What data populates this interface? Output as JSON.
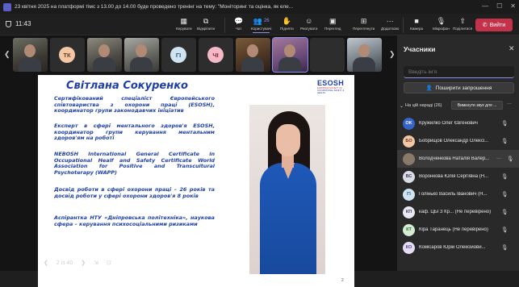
{
  "window": {
    "title": "23 квітня 2025 на платформі тімс з 13.00 до 14.00 буде проведено тренінг на тему: \"Моніторинг та оцінка, як еле...",
    "controls": [
      "—",
      "☐",
      "✕"
    ]
  },
  "toolbar": {
    "time": "11:43",
    "buttons": [
      {
        "label": "Керувати",
        "icon": "▦"
      },
      {
        "label": "Відкріпити",
        "icon": "⧉"
      },
      {
        "label": "Чат",
        "icon": "💬"
      },
      {
        "label": "Користувачі",
        "icon": "👥",
        "badge": "26"
      },
      {
        "label": "Підняти",
        "icon": "✋"
      },
      {
        "label": "Реагувати",
        "icon": "☺"
      },
      {
        "label": "Перегляд",
        "icon": "▣"
      },
      {
        "label": "Переглянути",
        "icon": "⊞"
      },
      {
        "label": "Додатково",
        "icon": "···"
      },
      {
        "label": "Камера",
        "icon": "■"
      },
      {
        "label": "Мікрофон",
        "icon": "🎙"
      },
      {
        "label": "Поділитися",
        "icon": "⇧"
      }
    ],
    "leave_label": "Вийти"
  },
  "strip": {
    "tiles": [
      {
        "kind": "cam",
        "initials": ""
      },
      {
        "kind": "avatar",
        "initials": "ТК",
        "color": "#f3c6a5",
        "fg": "#6b3a1e"
      },
      {
        "kind": "cam2",
        "initials": ""
      },
      {
        "kind": "cam3",
        "initials": ""
      },
      {
        "kind": "avatar",
        "initials": "ГІ",
        "color": "#cfe3f0",
        "fg": "#2a5877"
      },
      {
        "kind": "avatar",
        "initials": "ЧІ",
        "color": "#f4b9c5",
        "fg": "#7d2236"
      },
      {
        "kind": "cam4",
        "initials": ""
      },
      {
        "kind": "speaker",
        "initials": ""
      },
      {
        "kind": "avatar",
        "initials": "",
        "color": "#2d2d2d",
        "fg": "#2d2d2d"
      },
      {
        "kind": "cam5",
        "initials": ""
      }
    ]
  },
  "slide": {
    "title": "Світлана Сокуренко",
    "logo_main": "ESOSH",
    "logo_sub1": "EUROPEAN SOCIETY OF",
    "logo_sub2": "OCCUPATIONAL SAFETY & HEALTH",
    "paragraphs": [
      "Сертифікований спеціаліст Європейського співтовариства з охорони праці (ESOSH), координатор групи законодавчих ініціатив",
      "Експерт в сфері ментального здоров'я ESOSH, координатор групи керування ментальним здоров'ям на роботі",
      "NEBOSH International General Certificate in Occupational Healf and Safety Certificate World Association for Positive and Transcultural Psychoterapy (WAPP)",
      "Досвід роботи в сфері охорони праці – 26 років та досвід роботи у сфері охорони здоров'я 8 років",
      "Аспірантка НТУ «Дніпровська політехніка», наукова сфера – керування психосоціальними ризиками"
    ],
    "page_number": "2"
  },
  "pager": {
    "prev": "❮",
    "text": "2 із 40",
    "next": "❯",
    "extra1": "⇲",
    "extra2": "⊡"
  },
  "panel": {
    "title": "Учасники",
    "close": "✕",
    "search_placeholder": "Введіть ім'я",
    "share_label": "Поширити запрошення",
    "group_label": "На цій нараді (26)",
    "mute_all": "Вимкнути звук для ...",
    "participants": [
      {
        "initials": "OK",
        "name": "Кружилко Олег Євгенович",
        "color": "#3563c9",
        "fg": "#ffffff"
      },
      {
        "initials": "БО",
        "name": "Бобрищов Олександр Олексі...",
        "color": "#f3c6a5",
        "fg": "#6b3a1e"
      },
      {
        "initials": "",
        "name": "Володченкова Наталія Валер...",
        "color": "#8a7a6a",
        "fg": "#ffffff"
      },
      {
        "initials": "ВС",
        "name": "Воронкова Юлія Сергіївна (Н...",
        "color": "#d9dbe6",
        "fg": "#3b3f56"
      },
      {
        "initials": "ГІ",
        "name": "Голінько Василь Іванович (Н...",
        "color": "#cfe3f0",
        "fg": "#2a5877"
      },
      {
        "initials": "КП",
        "name": "каф. ЦБГЗ Кр... (Не перевірено)",
        "color": "#e9eaf5",
        "fg": "#3b3f56"
      },
      {
        "initials": "КТ",
        "name": "Кіра Таранець (Не перевірено)",
        "color": "#d4ecd4",
        "fg": "#2f6b2f"
      },
      {
        "initials": "КО",
        "name": "Комісаров Юрій Олексійови...",
        "color": "#e4dcf1",
        "fg": "#5a3d8a"
      }
    ]
  }
}
